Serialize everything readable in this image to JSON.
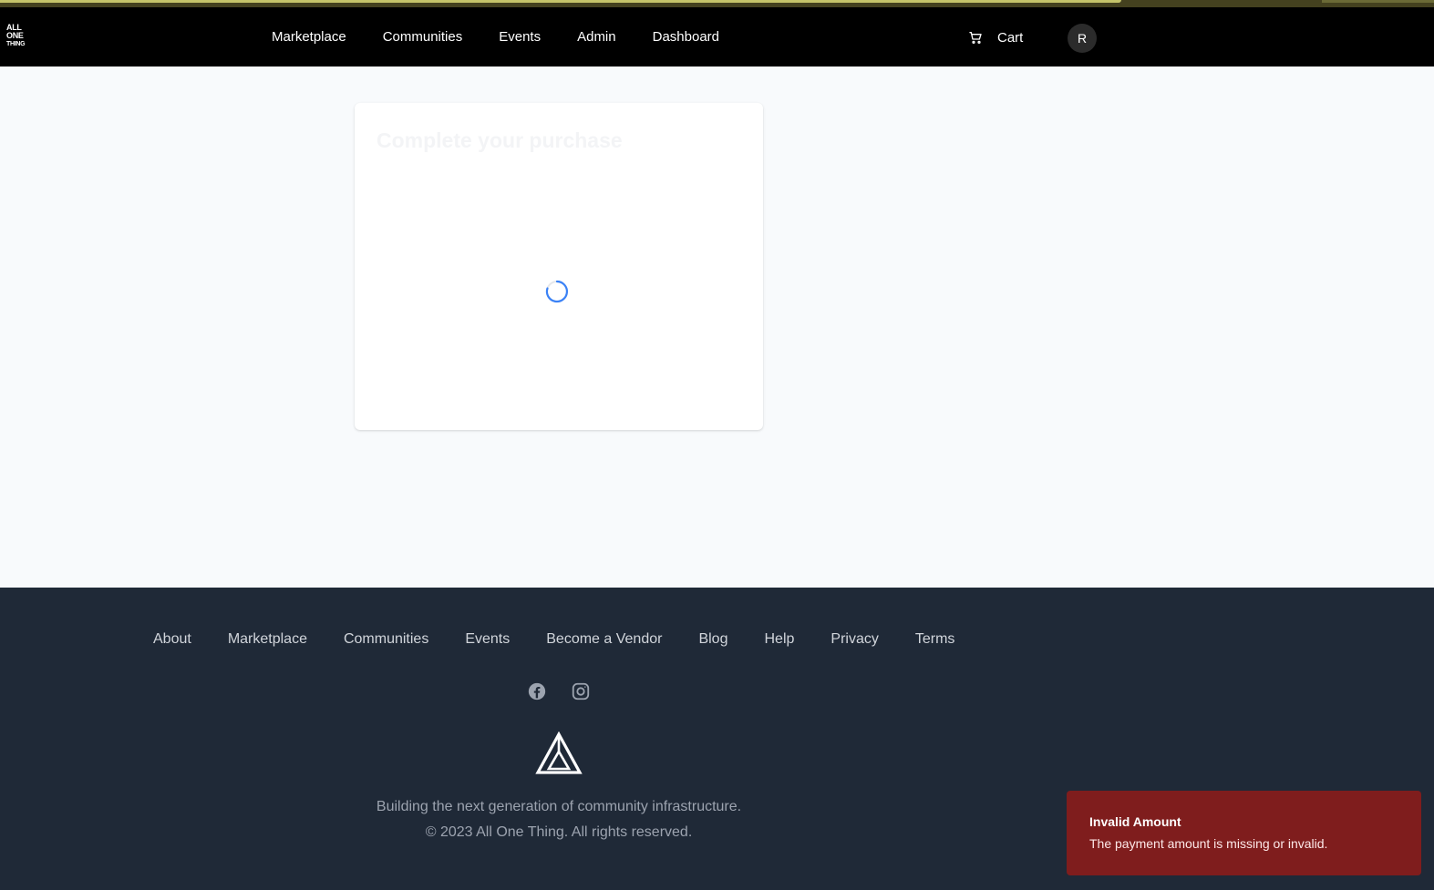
{
  "brand": {
    "logo_lines": [
      "ALL",
      "ONE",
      "THING"
    ]
  },
  "header": {
    "nav": [
      "Marketplace",
      "Communities",
      "Events",
      "Admin",
      "Dashboard"
    ],
    "cart_label": "Cart",
    "avatar_initial": "R",
    "cart_icon": "cart-icon"
  },
  "main": {
    "card_title": "Complete your purchase",
    "loading_icon": "spinner-icon",
    "accent_color": "#3b82f6"
  },
  "footer": {
    "links": [
      "About",
      "Marketplace",
      "Communities",
      "Events",
      "Become a Vendor",
      "Blog",
      "Help",
      "Privacy",
      "Terms"
    ],
    "social_icons": [
      "facebook-icon",
      "instagram-icon"
    ],
    "tagline": "Building the next generation of community infrastructure.",
    "copyright": "© 2023 All One Thing. All rights reserved."
  },
  "toast": {
    "title": "Invalid Amount",
    "message": "The payment amount is missing or invalid.",
    "color": "#7f1d1d"
  }
}
